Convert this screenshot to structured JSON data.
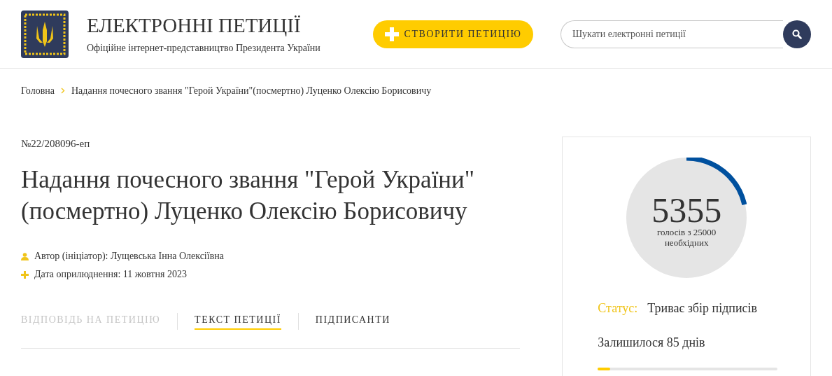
{
  "header": {
    "title": "ЕЛЕКТРОННІ ПЕТИЦІЇ",
    "subtitle": "Офіційне інтернет-представництво Президента України",
    "create_button": "СТВОРИТИ ПЕТИЦІЮ",
    "search": {
      "placeholder": "Шукати електронні петиції"
    }
  },
  "breadcrumbs": [
    "Головна",
    "Надання почесного звання \"Герой України\"(посмертно) Луценко Олексію Борисовичу"
  ],
  "petition": {
    "number": "№22/208096-еп",
    "title": "Надання почесного звання \"Герой України\" (посмертно) Луценко Олексію Борисовичу",
    "meta": [
      {
        "kind": "author",
        "text": "Автор (ініціатор): Лущевська Інна Олексіївна"
      },
      {
        "kind": "date",
        "text": "Дата оприлюднення: 11 жовтня 2023"
      }
    ],
    "tabs": [
      {
        "label": "ВІДПОВІДЬ НА ПЕТИЦІЮ",
        "selected": false,
        "disabled": true
      },
      {
        "label": "ТЕКСТ ПЕТИЦІЇ",
        "selected": true,
        "disabled": false
      },
      {
        "label": "ПІДПИСАНТИ",
        "selected": false,
        "disabled": false
      }
    ]
  },
  "stats": {
    "votes": "5355",
    "votes_caption": "голосів з 25000 необхідних",
    "status_label": "Статус:",
    "status_value": "Триває збір підписів",
    "remaining": "Залишилося 85 днів",
    "time": {
      "level": 0.07
    }
  }
}
